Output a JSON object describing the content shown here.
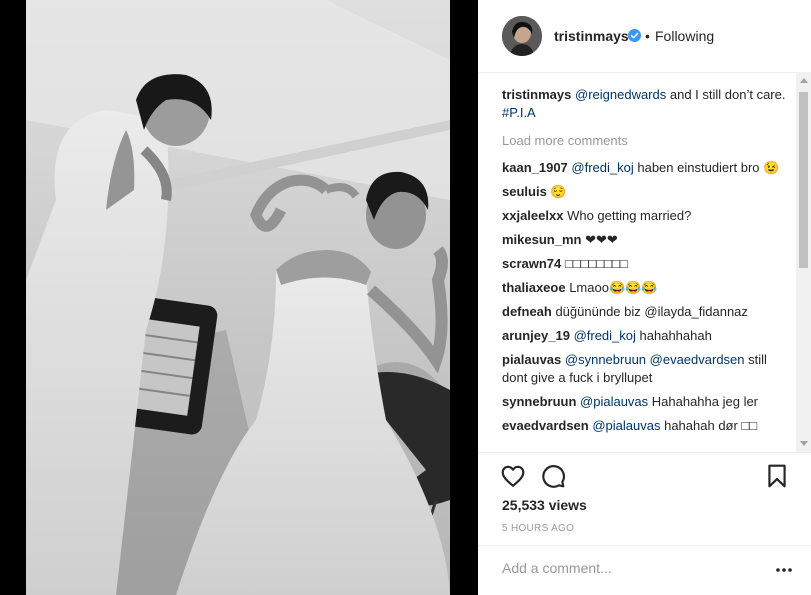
{
  "post": {
    "username": "tristinmays",
    "follow_status": "Following",
    "dot": "•",
    "caption": {
      "user": "tristinmays",
      "mention": "@reignedwards",
      "text": " and I still don’t care. ",
      "hashtag": "#P.I.A"
    },
    "load_more": "Load more comments",
    "comments": [
      {
        "user": "kaan_1907",
        "mention": "@fredi_koj",
        "text": " haben einstudiert bro 😉"
      },
      {
        "user": "seuluis",
        "mention": "",
        "text": " 😌"
      },
      {
        "user": "xxjaleelxx",
        "mention": "",
        "text": " Who getting married?"
      },
      {
        "user": "mikesun_mn",
        "mention": "",
        "text": " ❤❤❤"
      },
      {
        "user": "scrawn74",
        "mention": "",
        "text": " □□□□□□□□"
      },
      {
        "user": "thaliaxeoe",
        "mention": "",
        "text": " Lmaoo😂😂😂"
      },
      {
        "user": "defneah",
        "mention": "",
        "text": " düğününde biz @ilayda_fidannaz"
      },
      {
        "user": "arunjey_19",
        "mention": "@fredi_koj",
        "text": " hahahhahah"
      },
      {
        "user": "pialauvas",
        "mention": "@synnebruun @evaedvardsen",
        "text": " still dont give a fuck i bryllupet"
      },
      {
        "user": "synnebruun",
        "mention": "@pialauvas",
        "text": " Hahahahha jeg ler"
      },
      {
        "user": "evaedvardsen",
        "mention": "@pialauvas",
        "text": " hahahah dør □□"
      }
    ],
    "views": "25,533 views",
    "time": "5 HOURS AGO",
    "add_comment_placeholder": "Add a comment..."
  },
  "icons": {
    "verified": "verified-badge-icon",
    "like": "heart-icon",
    "comment": "comment-bubble-icon",
    "save": "bookmark-icon",
    "more": "more-options-icon"
  },
  "colors": {
    "verified": "#3897f0",
    "mention": "#003569",
    "muted": "#999999",
    "text": "#262626"
  }
}
